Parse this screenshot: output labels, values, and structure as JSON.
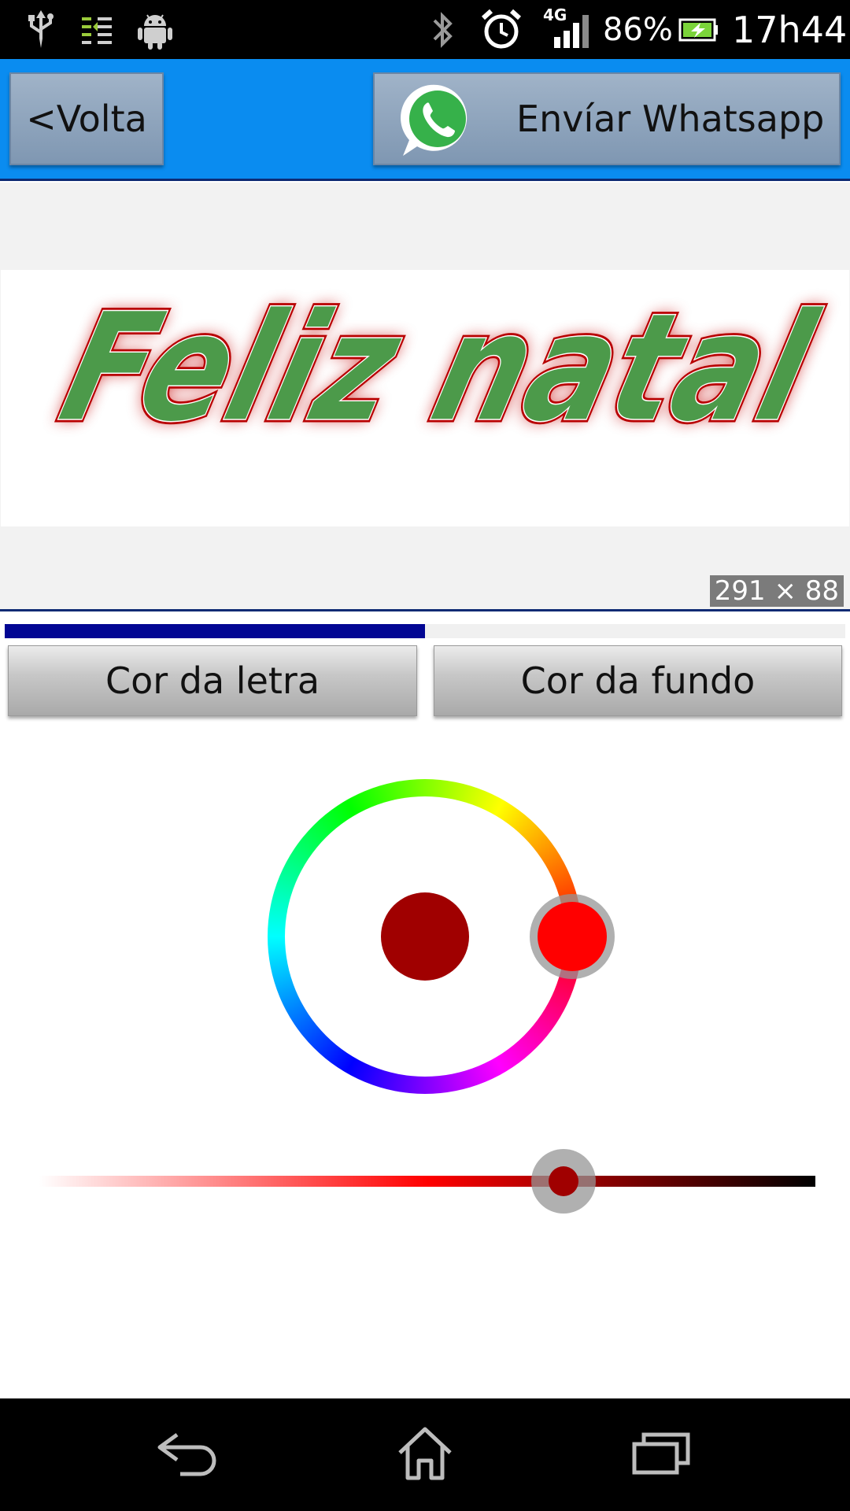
{
  "status_bar": {
    "network_type": "4G",
    "battery_percent": "86%",
    "time": "17h44",
    "icons": [
      "usb-icon",
      "data-sync-icon",
      "android-icon",
      "bluetooth-icon",
      "alarm-icon",
      "signal-icon",
      "battery-charging-icon"
    ]
  },
  "toolbar": {
    "back_label": "<Volta",
    "whatsapp_label": "Envíar Whatsapp",
    "whatsapp_icon": "whatsapp-icon",
    "background_color": "#0a8cf0"
  },
  "preview": {
    "text": "Feliz natal",
    "text_fill_color": "#4c9a4a",
    "text_outline_color": "#b80000",
    "size_badge": "291 × 88"
  },
  "progress": {
    "value_fraction": 0.5,
    "color": "#020693"
  },
  "buttons": {
    "text_color_label": "Cor da letra",
    "background_color_label": "Cor da fundo"
  },
  "color_picker": {
    "selected_hue_color": "#ff0000",
    "hue_degrees": 0,
    "result_color": "#a00000",
    "shade_fraction": 0.675
  },
  "nav_bar": {
    "icons": [
      "back-icon",
      "home-icon",
      "recent-apps-icon"
    ]
  }
}
